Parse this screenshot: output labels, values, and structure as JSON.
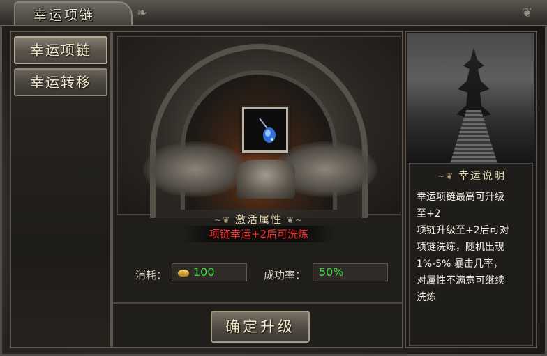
{
  "window": {
    "title": "幸运项链"
  },
  "menu": {
    "items": [
      {
        "label": "幸运项链"
      },
      {
        "label": "幸运转移"
      }
    ]
  },
  "stage": {
    "slot_item_icon": "necklace-icon"
  },
  "attributes": {
    "title": "激活属性",
    "value": "项链幸运+2后可洗炼"
  },
  "cost": {
    "label": "消耗：",
    "value": "100",
    "icon": "gold-ingot-icon"
  },
  "success": {
    "label": "成功率：",
    "value": "50%"
  },
  "actions": {
    "upgrade_label": "确定升级"
  },
  "info": {
    "title": "幸运说明",
    "lines": [
      "幸运项链最高可升级",
      "至+2",
      "项链升级至+2后可对",
      "项链洗炼，随机出现",
      "1%-5% 暴击几率，",
      "对属性不满意可继续",
      "洗炼"
    ]
  },
  "colors": {
    "accent_red": "#ff2a2a",
    "accent_green": "#3ddc3d",
    "text_gold": "#e6d7b3"
  }
}
